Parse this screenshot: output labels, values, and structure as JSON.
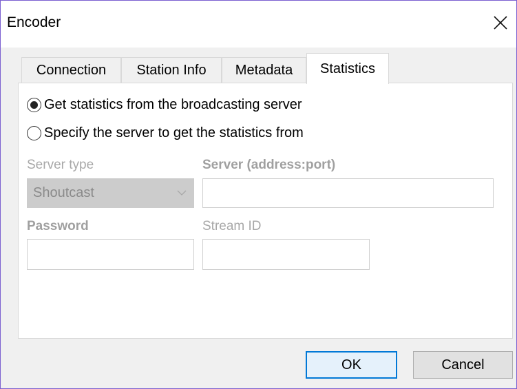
{
  "window": {
    "title": "Encoder"
  },
  "tabs": [
    {
      "label": "Connection",
      "active": false
    },
    {
      "label": "Station Info",
      "active": false
    },
    {
      "label": "Metadata",
      "active": false
    },
    {
      "label": "Statistics",
      "active": true
    }
  ],
  "statistics": {
    "option_broadcasting": {
      "label": "Get statistics from the broadcasting server",
      "selected": true
    },
    "option_specify": {
      "label": "Specify the server to get the statistics from",
      "selected": false
    },
    "server_type": {
      "label": "Server type",
      "value": "Shoutcast"
    },
    "server_address": {
      "label": "Server (address:port)",
      "value": ""
    },
    "password": {
      "label": "Password",
      "value": ""
    },
    "stream_id": {
      "label": "Stream ID",
      "value": ""
    }
  },
  "buttons": {
    "ok": "OK",
    "cancel": "Cancel"
  },
  "icons": {
    "close": "close-icon",
    "dropdown": "chevron-down-icon"
  },
  "colors": {
    "accent": "#0078d7",
    "window_border": "#7a5fd0",
    "disabled_text": "#a8a8a8"
  }
}
